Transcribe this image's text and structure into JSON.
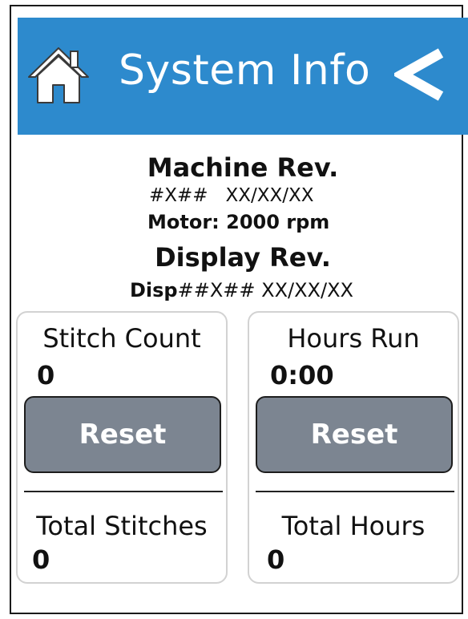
{
  "header": {
    "title": "System Info",
    "color": "#2d8acd"
  },
  "machine": {
    "title": "Machine Rev.",
    "revision": "#X##   XX/XX/XX",
    "motor": "Motor: 2000 rpm"
  },
  "display": {
    "title": "Display Rev.",
    "prefix": "Disp",
    "revision": "##X## XX/XX/XX"
  },
  "stitch": {
    "label": "Stitch Count",
    "value": "0",
    "reset_label": "Reset",
    "total_label": "Total Stitches",
    "total_value": "0"
  },
  "hours": {
    "label": "Hours Run",
    "value": "0:00",
    "reset_label": "Reset",
    "total_label": "Total Hours",
    "total_value": "0"
  },
  "icons": {
    "home": "home-icon",
    "back": "back-chevron-icon"
  }
}
